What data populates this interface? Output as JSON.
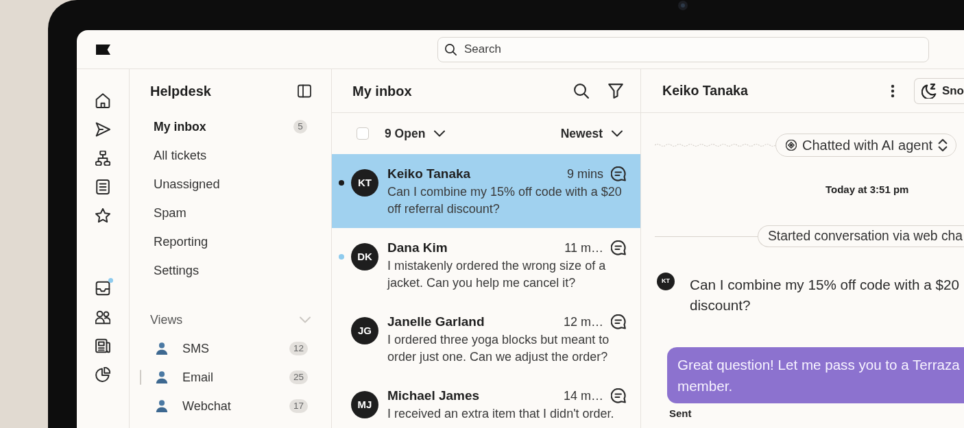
{
  "top_bar": {
    "search": {
      "placeholder": "Search"
    }
  },
  "rail": {
    "inbox_notification": true
  },
  "helpdesk": {
    "title": "Helpdesk",
    "nav": [
      {
        "label": "My inbox",
        "count": "5",
        "selected": true
      },
      {
        "label": "All tickets",
        "selected": false
      },
      {
        "label": "Unassigned",
        "selected": false
      },
      {
        "label": "Spam",
        "selected": false
      },
      {
        "label": "Reporting",
        "selected": false
      },
      {
        "label": "Settings",
        "selected": false
      }
    ],
    "views": {
      "title": "Views",
      "expanded": true,
      "items": [
        {
          "label": "SMS",
          "count": "12",
          "hovered": false
        },
        {
          "label": "Email",
          "count": "25",
          "hovered": true
        },
        {
          "label": "Webchat",
          "count": "17",
          "hovered": false
        }
      ]
    }
  },
  "inbox": {
    "title": "My inbox",
    "select_all": {
      "checked": false
    },
    "status_filter": {
      "label": "9 Open"
    },
    "sort": {
      "label": "Newest"
    },
    "conversations": [
      {
        "initials": "KT",
        "name": "Keiko Tanaka",
        "time": "9 mins",
        "preview": "Can I combine my 15% off code with a $20 off referral discount?",
        "selected": true,
        "unread": true,
        "color": "#1c1c1c"
      },
      {
        "initials": "DK",
        "name": "Dana Kim",
        "time": "11 m…",
        "preview": "I mistakenly ordered the wrong size of a jacket. Can you help me cancel it?",
        "selected": false,
        "unread": true,
        "color": "#8ecbee"
      },
      {
        "initials": "JG",
        "name": "Janelle Garland",
        "time": "12 m…",
        "preview": "I ordered three yoga blocks but meant to order just one. Can we adjust the order?",
        "selected": false,
        "unread": false
      },
      {
        "initials": "MJ",
        "name": "Michael James",
        "time": "14 m…",
        "preview": "I received an extra item that I didn't order.",
        "selected": false,
        "unread": false
      }
    ]
  },
  "conversation": {
    "title": "Keiko Tanaka",
    "snooze": {
      "label": "Sno"
    },
    "events": [
      {
        "kind": "ai_summary",
        "label": "Chatted with AI agent"
      },
      {
        "kind": "timestamp",
        "label": "Today at 3:51 pm"
      },
      {
        "kind": "system",
        "label": "Started conversation via web cha"
      },
      {
        "kind": "incoming",
        "initials": "KT",
        "lines": [
          "Can I combine my 15% off code with a $20",
          "discount?"
        ]
      },
      {
        "kind": "outgoing",
        "lines": [
          "Great question! Let me pass you to a Terraza",
          "member."
        ],
        "status": "Sent"
      }
    ]
  }
}
